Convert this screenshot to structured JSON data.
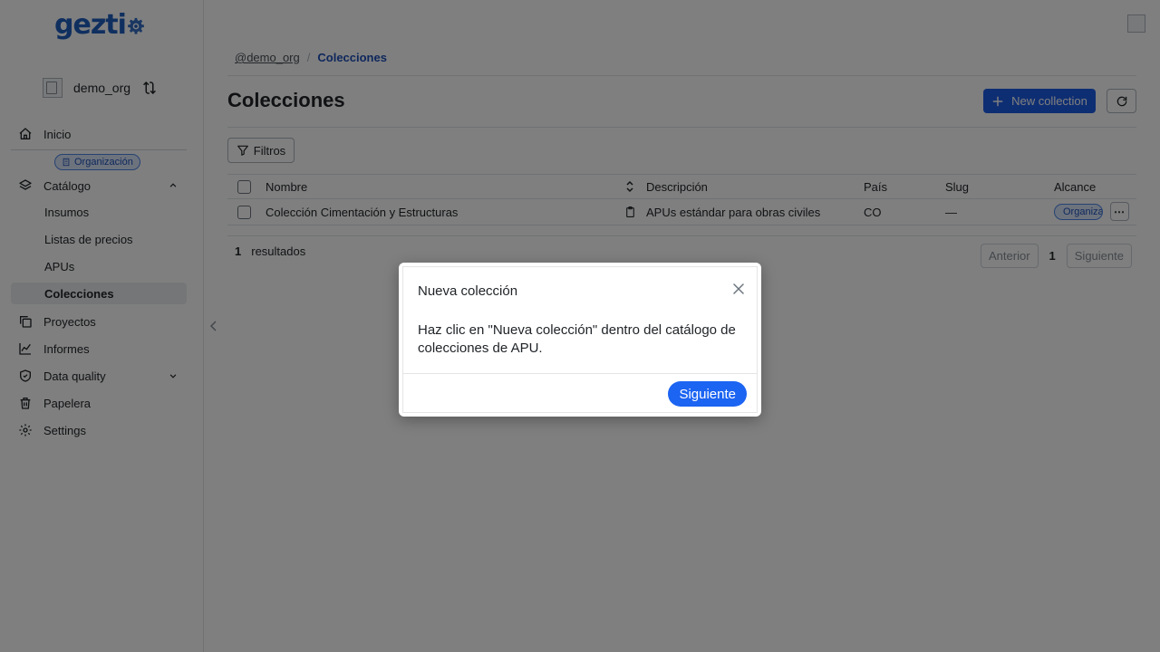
{
  "sidebar": {
    "logo_text": "gezti",
    "org_name": "demo_org",
    "items": [
      {
        "label": "Inicio"
      },
      {
        "label": "Catálogo"
      },
      {
        "label": "Insumos"
      },
      {
        "label": "Listas de precios"
      },
      {
        "label": "APUs"
      },
      {
        "label": "Colecciones"
      },
      {
        "label": "Proyectos"
      },
      {
        "label": "Informes"
      },
      {
        "label": "Data quality"
      },
      {
        "label": "Papelera"
      },
      {
        "label": "Settings"
      }
    ],
    "org_badge": "Organización"
  },
  "breadcrumb": {
    "root": "@demo_org",
    "separator": "/",
    "current": "Colecciones"
  },
  "header": {
    "title": "Colecciones",
    "new_button": "New collection"
  },
  "filters": {
    "label": "Filtros"
  },
  "table": {
    "columns": [
      "Nombre",
      "Descripción",
      "País",
      "Slug",
      "Alcance"
    ],
    "rows": [
      {
        "nombre": "Colección Cimentación y Estructuras",
        "descripcion": "APUs estándar para obras civiles",
        "pais": "CO",
        "slug": "—",
        "alcance": "Organización"
      }
    ],
    "more_label": "⋯"
  },
  "footer": {
    "count": "1",
    "results_label": "resultados",
    "prev": "Anterior",
    "page": "1",
    "next": "Siguiente"
  },
  "modal": {
    "title": "Nueva colección",
    "body": "Haz clic en \"Nueva colección\" dentro del catálogo de colecciones de APU.",
    "next_button": "Siguiente"
  },
  "colors": {
    "primary": "#1c5ce6",
    "brand": "#1f5fbf",
    "badge_bg": "#dbe7fb"
  }
}
